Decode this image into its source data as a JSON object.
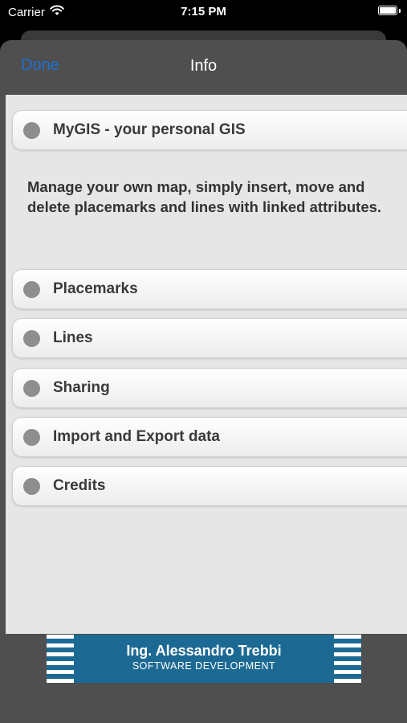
{
  "status_bar": {
    "carrier": "Carrier",
    "time": "7:15 PM"
  },
  "navbar": {
    "done_label": "Done",
    "title": "Info"
  },
  "header_item": {
    "label": "MyGIS - your personal GIS"
  },
  "description": "Manage your own map, simply insert, move and delete placemarks and lines with linked attributes.",
  "items": [
    {
      "label": "Placemarks"
    },
    {
      "label": "Lines"
    },
    {
      "label": "Sharing"
    },
    {
      "label": "Import and Export data"
    },
    {
      "label": "Credits"
    }
  ],
  "banner": {
    "title": "Ing. Alessandro Trebbi",
    "subtitle": "SOFTWARE DEVELOPMENT"
  },
  "colors": {
    "accent": "#1f6fd1",
    "banner": "#1c6a94",
    "sheet_bg": "#4f4f4f",
    "content_bg": "#e6e6e6"
  }
}
